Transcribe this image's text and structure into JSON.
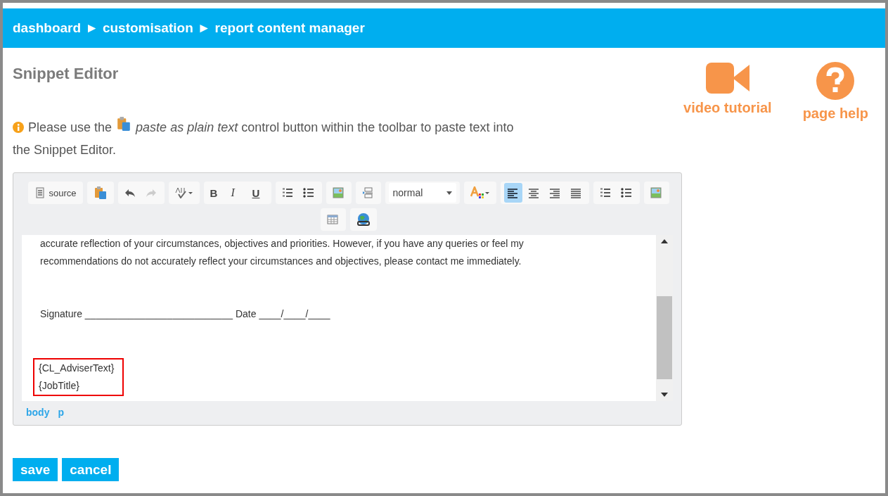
{
  "breadcrumb": [
    {
      "label": "dashboard"
    },
    {
      "label": "►"
    },
    {
      "label": "customisation"
    },
    {
      "label": "►"
    },
    {
      "label": "report content manager"
    }
  ],
  "title": "Snippet Editor",
  "help_links": [
    {
      "kind": "video",
      "label": "video tutorial"
    },
    {
      "kind": "help",
      "label": "page help"
    }
  ],
  "notice": {
    "before": "Please use the",
    "after": "*paste as plain text* control button within the toolbar to paste text into",
    "continued": "the Snippet Editor."
  },
  "toolbar": [
    [
      {
        "kind": "source",
        "label": "source"
      }
    ],
    [
      {
        "kind": "paste"
      }
    ],
    [
      {
        "kind": "undo"
      },
      {
        "kind": "redo",
        "disabled": true
      }
    ],
    [
      {
        "kind": "spell"
      }
    ],
    [
      {
        "kind": "bold",
        "label": "B"
      },
      {
        "kind": "italic",
        "label": "I"
      },
      {
        "kind": "underline",
        "label": "U"
      }
    ],
    [
      {
        "kind": "ol"
      },
      {
        "kind": "ul"
      }
    ],
    [
      {
        "kind": "image"
      }
    ],
    [
      {
        "kind": "pagebreak"
      }
    ],
    [
      {
        "kind": "select",
        "label": "normal"
      }
    ],
    [
      {
        "kind": "color"
      }
    ],
    [
      {
        "kind": "align-left",
        "selected": true
      },
      {
        "kind": "align-center",
        "selected": false
      },
      {
        "kind": "align-right",
        "selected": false
      },
      {
        "kind": "align-justify",
        "selected": false
      }
    ],
    [
      {
        "kind": "ol"
      },
      {
        "kind": "ul"
      }
    ],
    [
      {
        "kind": "image"
      }
    ],
    [
      {
        "kind": "table"
      }
    ],
    [
      {
        "kind": "link"
      }
    ]
  ],
  "content": [
    {
      "kind": "text",
      "text": "accurate reflection of your circumstances, objectives and priorities. However, if you have any queries or feel my"
    },
    {
      "kind": "text",
      "text": "recommendations do not accurately reflect your circumstances and objectives, please contact me immediately."
    },
    {
      "kind": "blank"
    },
    {
      "kind": "blank"
    },
    {
      "kind": "text",
      "text": "Signature ___________________________ Date ____/____/____"
    },
    {
      "kind": "blank"
    },
    {
      "kind": "blank"
    },
    {
      "kind": "highlight",
      "lines": [
        "{CL_AdviserText}",
        "{JobTitle}"
      ]
    }
  ],
  "path": [
    {
      "label": "body"
    },
    {
      "label": "p"
    }
  ],
  "buttons": [
    {
      "label": "save"
    },
    {
      "label": "cancel"
    }
  ]
}
